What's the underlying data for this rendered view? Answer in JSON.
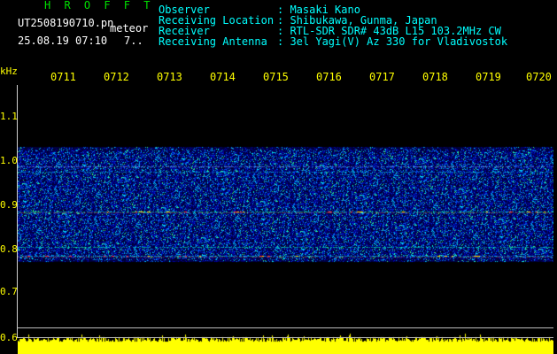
{
  "header": {
    "app_title": "H R O F F T",
    "file_name": "UT2508190710.pn",
    "meteor_label": "meteor",
    "datetime": "25.08.19 07:10",
    "count": "7.."
  },
  "info": {
    "observer_label": "Observer",
    "observer_value": ": Masaki Kano",
    "location_label": "Receiving Location",
    "location_value": ": Shibukawa, Gunma, Japan",
    "receiver_label": "Receiver",
    "receiver_value": ": RTL-SDR SDR# 43dB L15 103.2MHz CW",
    "antenna_label": "Receiving Antenna",
    "antenna_value": ": 3el Yagi(V) Az 330 for Vladivostok"
  },
  "axis": {
    "unit": "kHz",
    "y_ticks": [
      "1.1",
      "1.0",
      "0.9",
      "0.8",
      "0.7",
      "0.6"
    ],
    "x_ticks": [
      "0711",
      "0712",
      "0713",
      "0714",
      "0715",
      "0716",
      "0717",
      "0718",
      "0719",
      "0720"
    ]
  },
  "colors": {
    "text_info": "#00ffff",
    "text_header": "#ffffff",
    "title": "#00e000",
    "axis": "#ffff00"
  }
}
